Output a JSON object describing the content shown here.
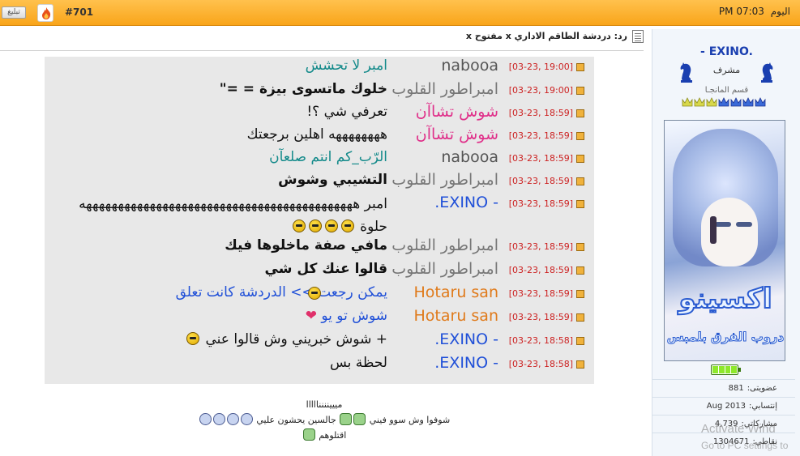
{
  "topbar": {
    "date_label": "اليوم",
    "time": "07:03 PM",
    "post_number": "#701",
    "report_label": "تبليغ"
  },
  "post": {
    "title": "رد: دردشة الطاقم الاداري x مفتوح x"
  },
  "user": {
    "name": "- EXINO.",
    "rank": "مشرف",
    "section": "قسم المانجـا",
    "avatar_logo": "اكسينو",
    "avatar_logo_sub": "دروب الفرق بلمبس",
    "stats": [
      {
        "key": "عضويتى:",
        "value": "881"
      },
      {
        "key": "إنتسابي:",
        "value": "Aug 2013"
      },
      {
        "key": "مشاركاتي:",
        "value": "4,739"
      },
      {
        "key": "نقاطي:",
        "value": "1304671"
      }
    ]
  },
  "shouts": [
    {
      "time": "[03-23, 19:00]",
      "user": "nabooa",
      "color": "#555555",
      "message": "امبر لا تحشش",
      "msg_color": "#138a8a",
      "bold": false
    },
    {
      "time": "[03-23, 19:00]",
      "user": "امبراطور القلوب",
      "color": "#777777",
      "message": "خلوك ماتسوى بيزة = =\"",
      "msg_color": "#111111",
      "bold": true
    },
    {
      "time": "[03-23, 18:59]",
      "user": "شوش تشاآن",
      "color": "#e0308a",
      "message": "تعرفي شي ؟!",
      "msg_color": "#111111",
      "bold": false
    },
    {
      "time": "[03-23, 18:59]",
      "user": "شوش تشاآن",
      "color": "#e0308a",
      "message": "ههههههههه اهلين برجعتك",
      "msg_color": "#111111",
      "bold": false
    },
    {
      "time": "[03-23, 18:59]",
      "user": "nabooa",
      "color": "#555555",
      "message": "الرّب_كم انتم صلعآن",
      "msg_color": "#138a8a",
      "bold": false
    },
    {
      "time": "[03-23, 18:59]",
      "user": "امبراطور القلوب",
      "color": "#777777",
      "message": "التشيبي وشوش",
      "msg_color": "#111111",
      "bold": true
    },
    {
      "time": "[03-23, 18:59]",
      "user": "- EXINO.",
      "color": "#2050d8",
      "message": "امبر هههههههههههههههههههههههههههههههههههههههههههه حلوة",
      "msg_color": "#111111",
      "bold": false
    },
    {
      "time": "[03-23, 18:59]",
      "user": "امبراطور القلوب",
      "color": "#777777",
      "message": "مافي صفة ماخلوها فيك",
      "msg_color": "#111111",
      "bold": true
    },
    {
      "time": "[03-23, 18:59]",
      "user": "امبراطور القلوب",
      "color": "#777777",
      "message": "قالوا عنك كل شي",
      "msg_color": "#111111",
      "bold": true
    },
    {
      "time": "[03-23, 18:59]",
      "user": "Hotaru san",
      "color": "#e07a1a",
      "message": "يمكن رجعت  >> الدردشة كانت تعلق",
      "msg_color": "#2050d8",
      "bold": false
    },
    {
      "time": "[03-23, 18:59]",
      "user": "Hotaru san",
      "color": "#e07a1a",
      "message": "شوش تو يو",
      "msg_color": "#2050d8",
      "bold": false
    },
    {
      "time": "[03-23, 18:58]",
      "user": "- EXINO.",
      "color": "#2050d8",
      "message": "+ شوش خبريني وش قالوا عني",
      "msg_color": "#111111",
      "bold": false
    },
    {
      "time": "[03-23, 18:58]",
      "user": "- EXINO.",
      "color": "#2050d8",
      "message": "لحظة بس",
      "msg_color": "#111111",
      "bold": false
    }
  ],
  "signature": {
    "line1": "ميييننننااااا",
    "line2": "شوفوا وش سوو فيني",
    "line2b": "جالسين يحشون عليي",
    "line3": "اقتلوهم"
  },
  "watermark": {
    "line1": "Activate Wind",
    "line2": "Go to PC settings to"
  }
}
